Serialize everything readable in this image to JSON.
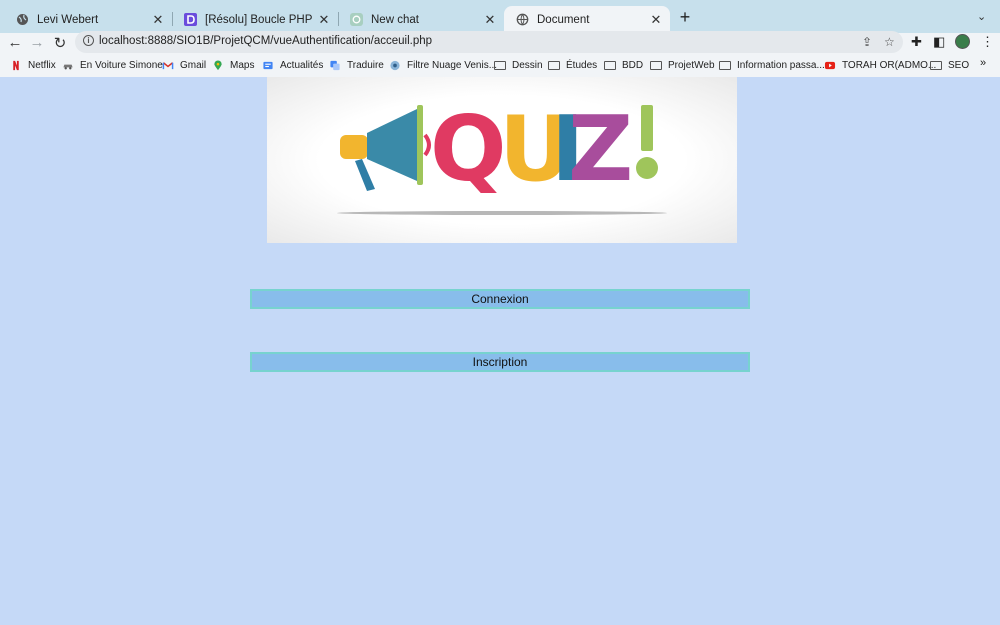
{
  "browser": {
    "tabs": [
      {
        "title": "Levi Webert",
        "icon": "globe-icon",
        "active": false
      },
      {
        "title": "[Résolu] Boucle PHP pour crée",
        "icon": "openclassrooms-icon",
        "active": false
      },
      {
        "title": "New chat",
        "icon": "chatgpt-icon",
        "active": false
      },
      {
        "title": "Document",
        "icon": "globe-icon",
        "active": true
      }
    ],
    "url": "localhost:8888/SIO1B/ProjetQCM/vueAuthentification/acceuil.php",
    "bookmarks": [
      {
        "label": "Netflix",
        "icon": "netflix-icon"
      },
      {
        "label": "En Voiture Simone",
        "icon": "car-icon"
      },
      {
        "label": "Gmail",
        "icon": "gmail-icon"
      },
      {
        "label": "Maps",
        "icon": "maps-pin-icon"
      },
      {
        "label": "Actualités",
        "icon": "news-icon"
      },
      {
        "label": "Traduire",
        "icon": "translate-icon"
      },
      {
        "label": "Filtre Nuage Venis...",
        "icon": "filter-icon"
      },
      {
        "label": "Dessin",
        "icon": "folder-icon"
      },
      {
        "label": "Études",
        "icon": "folder-icon"
      },
      {
        "label": "BDD",
        "icon": "folder-icon"
      },
      {
        "label": "ProjetWeb",
        "icon": "folder-icon"
      },
      {
        "label": "Information passa...",
        "icon": "folder-icon"
      },
      {
        "label": "TORAH OR(ADMO...",
        "icon": "youtube-icon"
      },
      {
        "label": "SEO",
        "icon": "folder-icon"
      }
    ],
    "bookmarks_more": "»"
  },
  "page": {
    "logo_text": "QUIZ!",
    "buttons": {
      "login": "Connexion",
      "signup": "Inscription"
    }
  },
  "colors": {
    "page_background": "#c5d9f7",
    "button_background": "#88bdeb",
    "button_border": "#77d3cf",
    "quiz_q": "#e03a62",
    "quiz_u": "#f2b52e",
    "quiz_i": "#2f7ea6",
    "quiz_z": "#a84d9c",
    "quiz_exclaim": "#9fc55b",
    "megaphone_body": "#3a8aa8",
    "megaphone_handle": "#f2b52e"
  }
}
